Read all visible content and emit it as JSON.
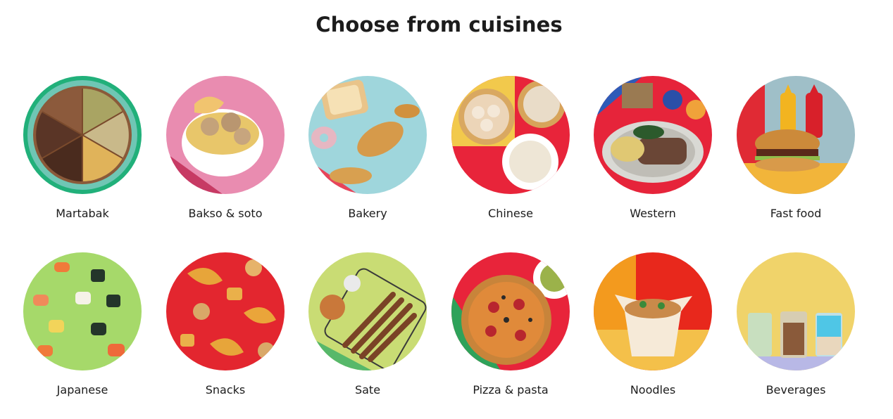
{
  "section": {
    "title": "Choose from cuisines"
  },
  "cuisines": [
    {
      "label": "Martabak"
    },
    {
      "label": "Bakso & soto"
    },
    {
      "label": "Bakery"
    },
    {
      "label": "Chinese"
    },
    {
      "label": "Western"
    },
    {
      "label": "Fast food"
    },
    {
      "label": "Japanese"
    },
    {
      "label": "Snacks"
    },
    {
      "label": "Sate"
    },
    {
      "label": "Pizza & pasta"
    },
    {
      "label": "Noodles"
    },
    {
      "label": "Beverages"
    }
  ]
}
